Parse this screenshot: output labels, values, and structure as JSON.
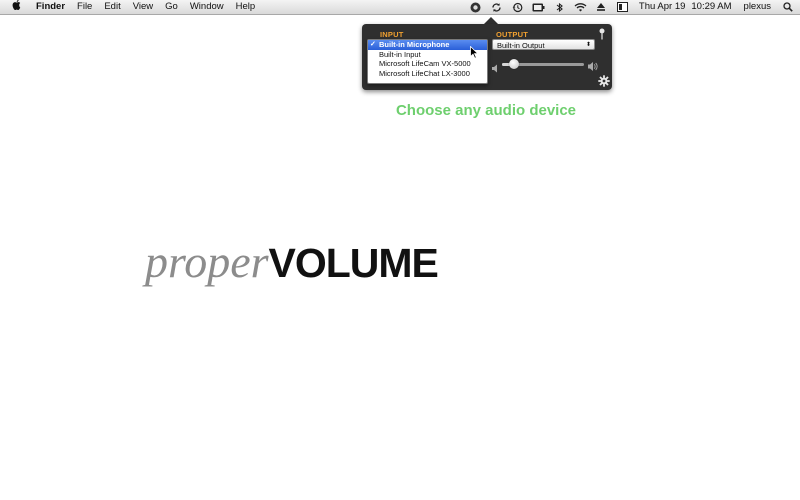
{
  "menubar": {
    "left_items": [
      "Finder",
      "File",
      "Edit",
      "View",
      "Go",
      "Window",
      "Help"
    ],
    "date": "Thu Apr 19",
    "time": "10:29 AM",
    "user": "plexus"
  },
  "panel": {
    "input_label": "INPUT",
    "output_label": "OUTPUT",
    "input_devices": [
      "Built-in Microphone",
      "Built-in Input",
      "Microsoft LifeCam VX-5000",
      "Microsoft LifeChat LX-3000"
    ],
    "selected_input_check": "✓",
    "output_device": "Built-in Output",
    "volume_fraction": 0.15
  },
  "caption": "Choose any audio device",
  "logo": {
    "part1": "proper",
    "part2": "VOLUME"
  },
  "colors": {
    "accent_orange": "#f0a030",
    "caption_green": "#6ecf6e",
    "panel_bg": "#2f2f2f",
    "selection_blue": "#2a5fd8"
  }
}
